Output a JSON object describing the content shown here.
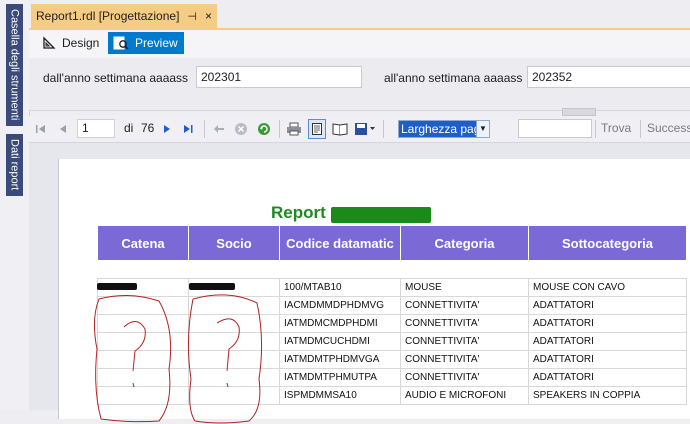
{
  "sidebar": {
    "tabs": [
      {
        "label": "Casella degli strumenti"
      },
      {
        "label": "Dati report"
      }
    ]
  },
  "document_tab": {
    "title": "Report1.rdl [Progettazione]",
    "pin_glyph": "⊣",
    "close_glyph": "×"
  },
  "view_switch": {
    "design_label": "Design",
    "preview_label": "Preview",
    "active": "Preview",
    "accent_color": "#007acc"
  },
  "parameters": [
    {
      "label": "dall'anno settimana aaaass",
      "value": "202301"
    },
    {
      "label": "all'anno settimana aaaass",
      "value": "202352"
    }
  ],
  "toolbar": {
    "current_page": "1",
    "of_label": "di",
    "total_pages": "76",
    "zoom_value": "Larghezza pagina",
    "find_placeholder": "",
    "find_label": "Trova",
    "next_label": "Successivo"
  },
  "report": {
    "title_visible": "Report",
    "title_color": "#208a22",
    "header_color": "#7b6ad6",
    "columns": [
      "Catena",
      "Socio",
      "Codice datamatic",
      "Categoria",
      "Sottocategoria"
    ],
    "rows": [
      {
        "codice": "100/MTAB10",
        "categoria": "MOUSE",
        "sottocategoria": "MOUSE CON CAVO"
      },
      {
        "codice": "IACMDMMDPHDMVG",
        "categoria": "CONNETTIVITA'",
        "sottocategoria": "ADATTATORI"
      },
      {
        "codice": "IATMDMCMDPHDMI",
        "categoria": "CONNETTIVITA'",
        "sottocategoria": "ADATTATORI"
      },
      {
        "codice": "IATMDMCUCHDMI",
        "categoria": "CONNETTIVITA'",
        "sottocategoria": "ADATTATORI"
      },
      {
        "codice": "IATMDMTPHDMVGA",
        "categoria": "CONNETTIVITA'",
        "sottocategoria": "ADATTATORI"
      },
      {
        "codice": "IATMDMTPHMUTPA",
        "categoria": "CONNETTIVITA'",
        "sottocategoria": "ADATTATORI"
      },
      {
        "codice": "ISPMDMMSA10",
        "categoria": "AUDIO E MICROFONI",
        "sottocategoria": "SPEAKERS IN COPPIA"
      }
    ]
  }
}
